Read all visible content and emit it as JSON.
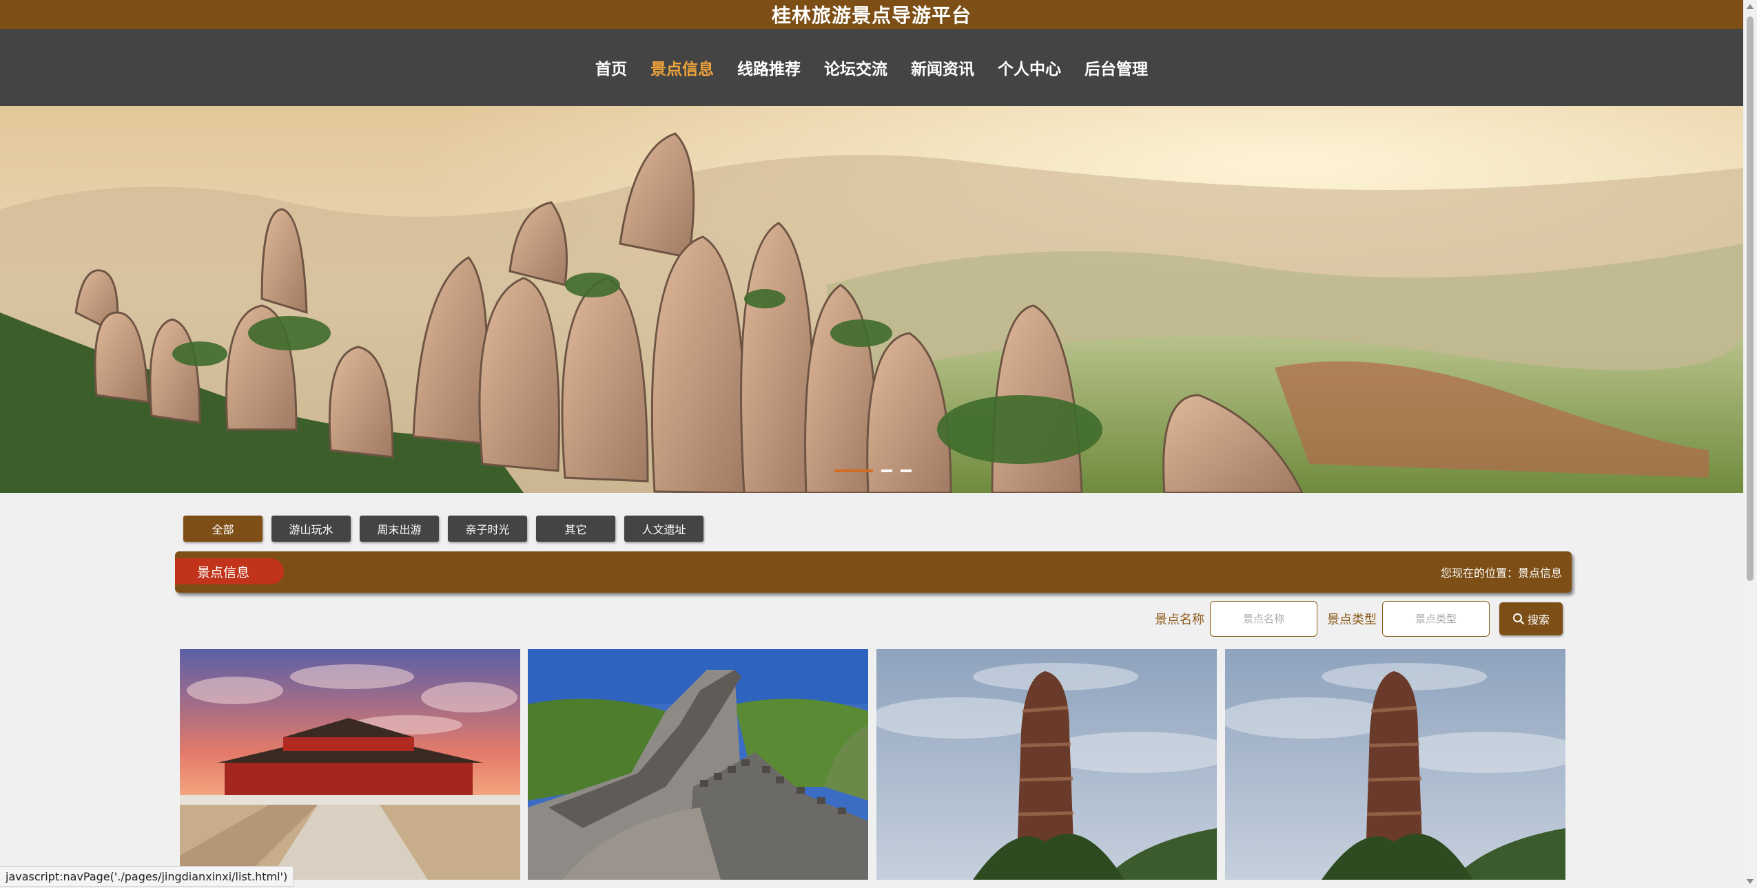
{
  "site_title": "桂林旅游景点导游平台",
  "nav": [
    {
      "label": "首页",
      "active": false
    },
    {
      "label": "景点信息",
      "active": true
    },
    {
      "label": "线路推荐",
      "active": false
    },
    {
      "label": "论坛交流",
      "active": false
    },
    {
      "label": "新闻资讯",
      "active": false
    },
    {
      "label": "个人中心",
      "active": false
    },
    {
      "label": "后台管理",
      "active": false
    }
  ],
  "categories": [
    {
      "label": "全部",
      "active": true
    },
    {
      "label": "游山玩水",
      "active": false
    },
    {
      "label": "周末出游",
      "active": false
    },
    {
      "label": "亲子时光",
      "active": false
    },
    {
      "label": "其它",
      "active": false
    },
    {
      "label": "人文遗址",
      "active": false
    }
  ],
  "section": {
    "title": "景点信息",
    "breadcrumb": "您现在的位置：景点信息"
  },
  "search": {
    "name_label": "景点名称",
    "name_placeholder": "景点名称",
    "type_label": "景点类型",
    "type_placeholder": "景点类型",
    "button_label": "搜索"
  },
  "cards": [
    {
      "image": "forbidden-city-gate"
    },
    {
      "image": "great-wall"
    },
    {
      "image": "stone-pillar"
    },
    {
      "image": "stone-pillar"
    }
  ],
  "status_text": "javascript:navPage('./pages/jingdianxinxi/list.html')",
  "colors": {
    "brand_brown": "#7d4f16",
    "nav_bg": "#444444",
    "nav_active": "#f0a43a",
    "section_tab_red": "#c1331a"
  }
}
